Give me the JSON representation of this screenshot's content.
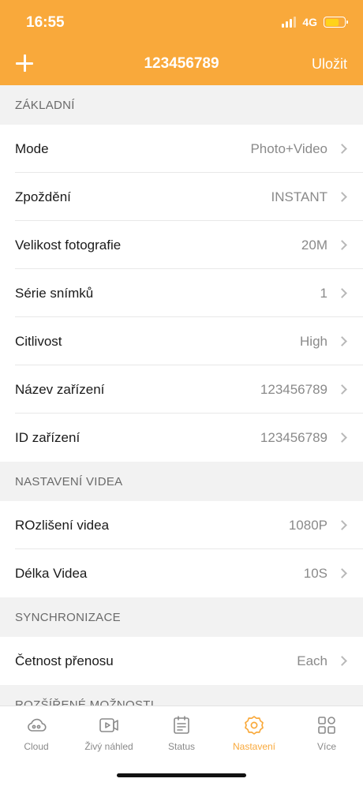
{
  "status_bar": {
    "time": "16:55",
    "network": "4G",
    "battery_color": "#ffd31a"
  },
  "header": {
    "title": "123456789",
    "save_label": "Uložit",
    "add_icon": "plus-icon",
    "bg_color": "#f9a93b"
  },
  "sections": [
    {
      "title": "ZÁKLADNÍ",
      "rows": [
        {
          "label": "Mode",
          "value": "Photo+Video"
        },
        {
          "label": "Zpoždění",
          "value": "INSTANT"
        },
        {
          "label": "Velikost fotografie",
          "value": "20M"
        },
        {
          "label": "Série snímků",
          "value": "1"
        },
        {
          "label": "Citlivost",
          "value": "High"
        },
        {
          "label": "Název zařízení",
          "value": "123456789"
        },
        {
          "label": "ID zařízení",
          "value": "123456789"
        }
      ]
    },
    {
      "title": "NASTAVENÍ VIDEA",
      "rows": [
        {
          "label": "ROzlišení videa",
          "value": "1080P"
        },
        {
          "label": "Délka Videa",
          "value": "10S"
        }
      ]
    },
    {
      "title": "SYNCHRONIZACE",
      "rows": [
        {
          "label": "Četnost přenosu",
          "value": "Each"
        }
      ]
    },
    {
      "title": "ROZŠÍŘENÉ MOŽNOSTI",
      "rows": []
    }
  ],
  "tabbar": {
    "active_color": "#f9a93b",
    "tabs": [
      {
        "label": "Cloud",
        "icon": "cloud-icon"
      },
      {
        "label": "Živý náhled",
        "icon": "live-preview-icon"
      },
      {
        "label": "Status",
        "icon": "status-icon"
      },
      {
        "label": "Nastavení",
        "icon": "settings-icon",
        "active": true
      },
      {
        "label": "Více",
        "icon": "more-icon"
      }
    ]
  }
}
